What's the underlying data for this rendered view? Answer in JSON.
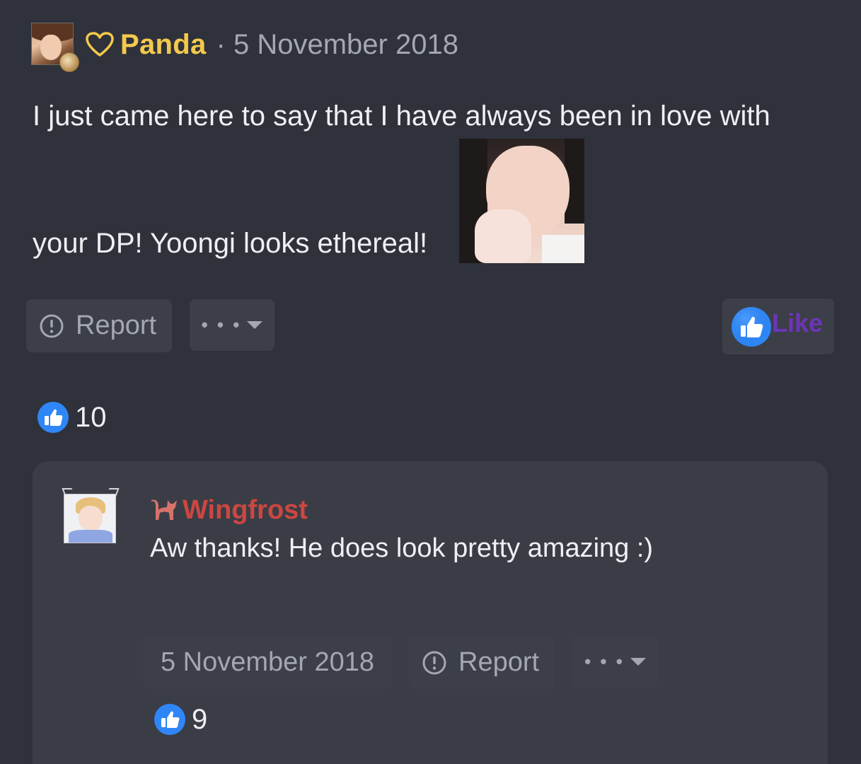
{
  "post": {
    "username": "Panda",
    "separator": "·",
    "date": "5 November 2018",
    "text_line1": "I just came here to say that I have always been in love with",
    "text_line2": "your DP! Yoongi looks ethereal!",
    "report_label": "Report",
    "more_label": "• • •",
    "like_label": "Like",
    "like_count": "10"
  },
  "reply": {
    "username": "Wingfrost",
    "text": "Aw thanks! He does look pretty amazing :)",
    "date": "5 November 2018",
    "report_label": "Report",
    "more_label": "• • •",
    "like_count": "9"
  },
  "colors": {
    "background": "#2f323b",
    "card": "#3a3d46",
    "button": "#3c3f48",
    "username_gold": "#f4c94c",
    "username_red": "#cc4740",
    "like_purple": "#6d35b8",
    "like_blue": "#2f86f6",
    "muted_text": "#a4a7b0"
  },
  "icons": [
    "heart-icon",
    "report-icon",
    "caret-down-icon",
    "like-thumb-icon",
    "cat-icon"
  ]
}
